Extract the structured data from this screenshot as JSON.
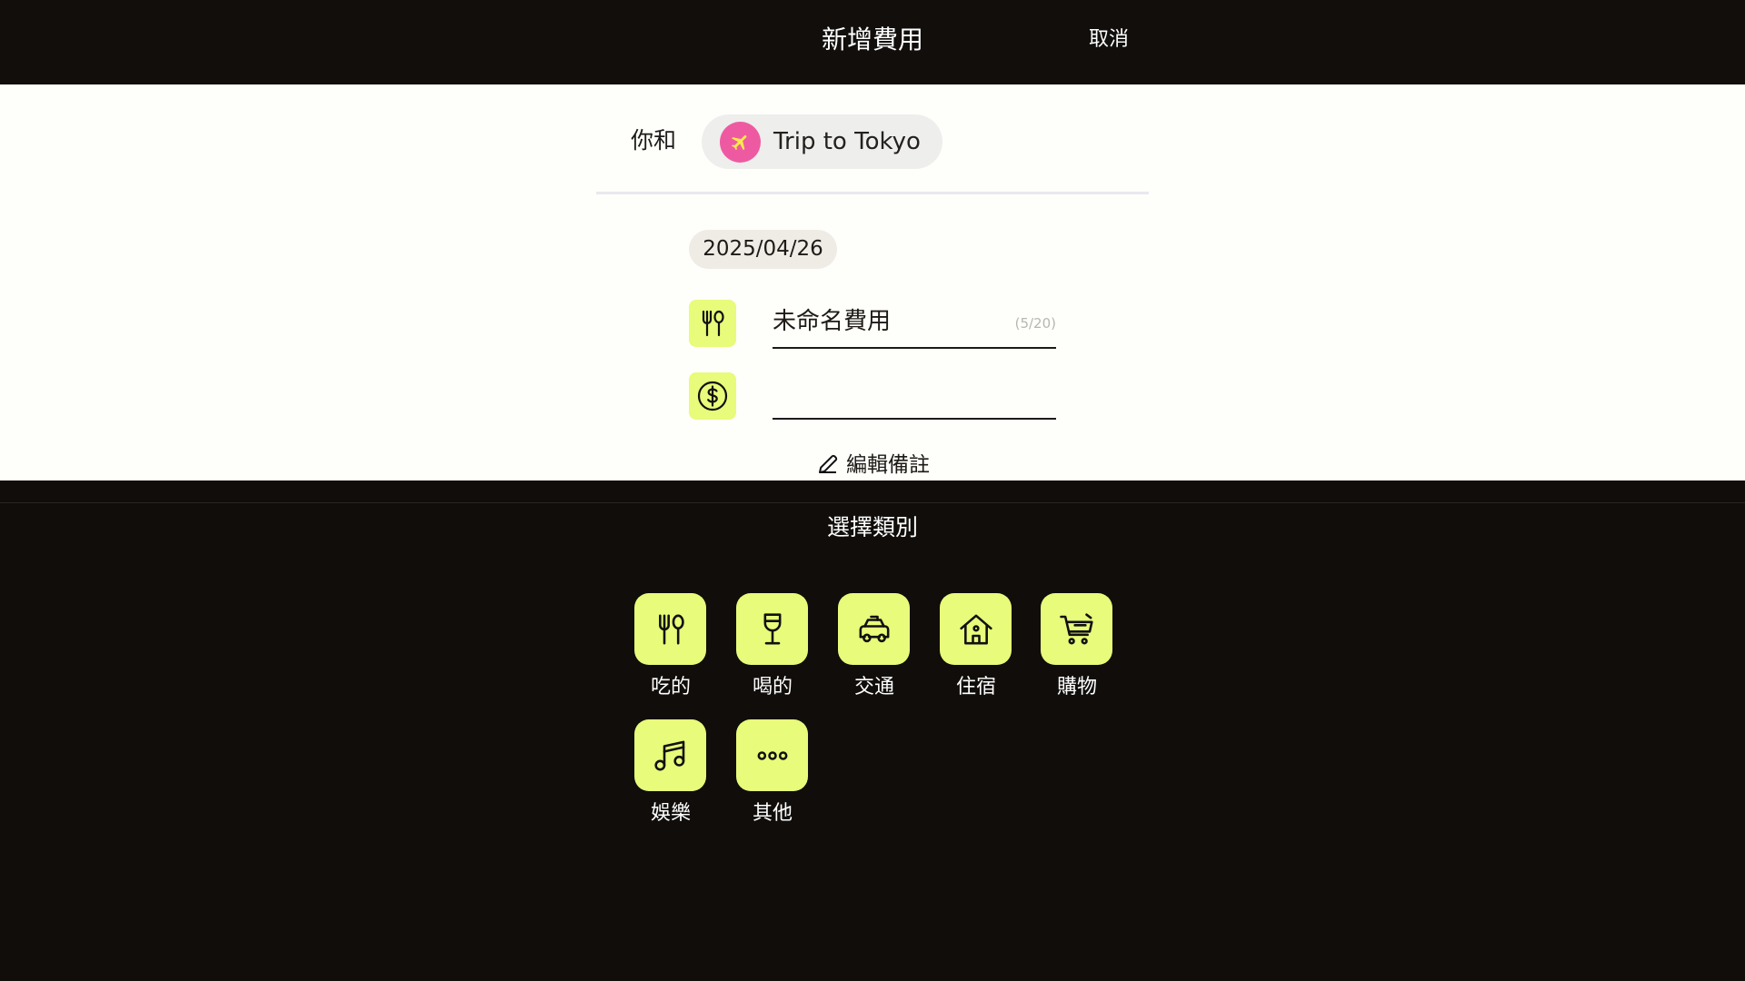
{
  "header": {
    "title": "新增費用",
    "cancel_label": "取消"
  },
  "participants": {
    "with_label": "你和",
    "group_name": "Trip to Tokyo",
    "group_avatar_icon": "airplane-icon",
    "group_avatar_color": "#ee5aa2"
  },
  "expense": {
    "date": "2025/04/26",
    "name_value": "未命名費用",
    "name_counter": "(5/20)",
    "amount_value": "",
    "category_icon": "fork-spoon-icon",
    "amount_icon": "dollar-circle-icon",
    "note_label": "編輯備註"
  },
  "category_sheet": {
    "title": "選擇類別",
    "categories": [
      {
        "label": "吃的",
        "icon": "fork-spoon-icon"
      },
      {
        "label": "喝的",
        "icon": "wine-glass-icon"
      },
      {
        "label": "交通",
        "icon": "taxi-icon"
      },
      {
        "label": "住宿",
        "icon": "house-icon"
      },
      {
        "label": "購物",
        "icon": "shopping-cart-icon"
      },
      {
        "label": "娛樂",
        "icon": "music-note-icon"
      },
      {
        "label": "其他",
        "icon": "more-dots-icon"
      }
    ]
  },
  "colors": {
    "accent": "#e8fb7a",
    "dark_background": "#100d0b",
    "form_background": "#fefefb"
  }
}
